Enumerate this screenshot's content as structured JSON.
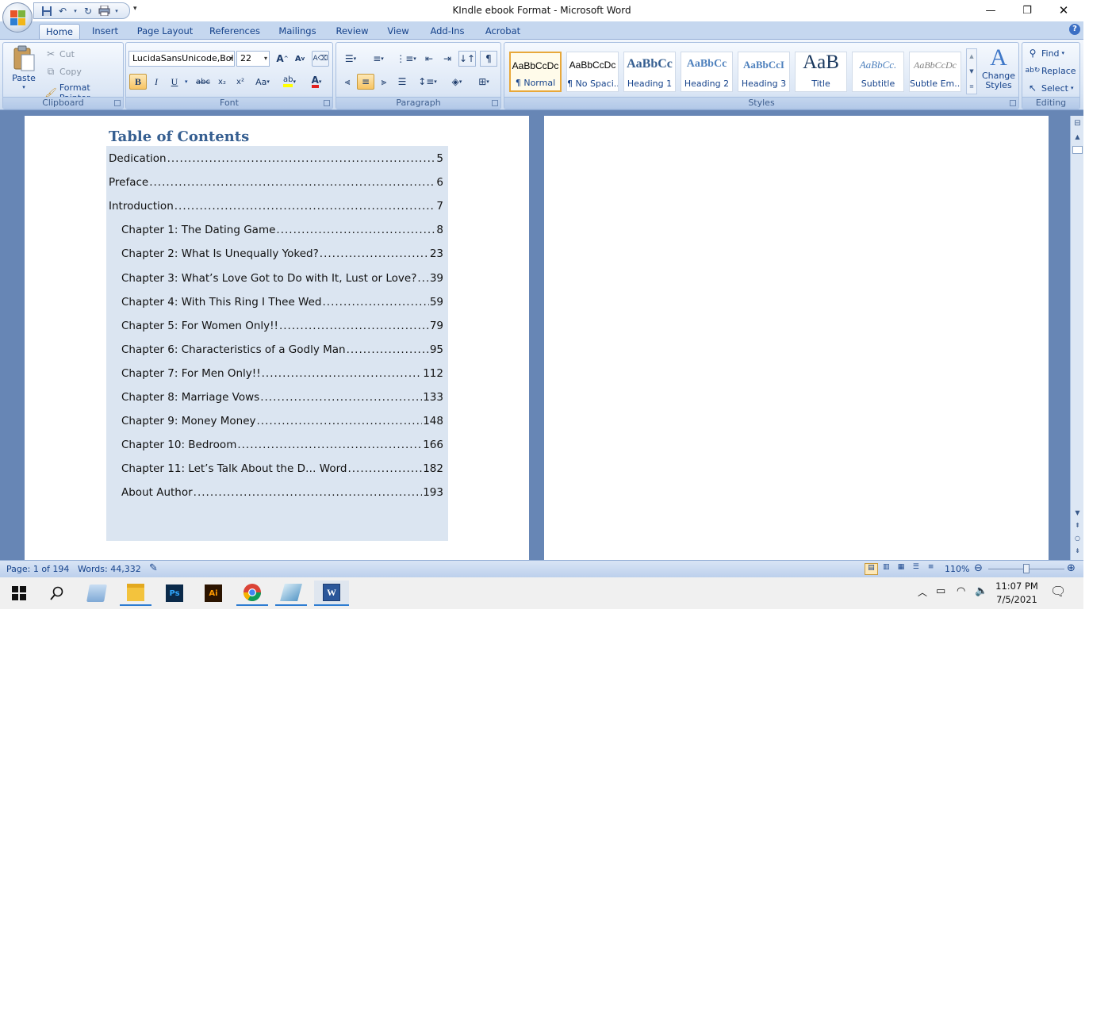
{
  "title": "KIndle ebook Format - Microsoft Word",
  "window_controls": {
    "minimize": "—",
    "restore": "❐",
    "close": "✕"
  },
  "qat": {
    "more": "▾"
  },
  "tabs": [
    "Home",
    "Insert",
    "Page Layout",
    "References",
    "Mailings",
    "Review",
    "View",
    "Add-Ins",
    "Acrobat"
  ],
  "active_tab": "Home",
  "help": "?",
  "clipboard": {
    "label": "Clipboard",
    "paste": "Paste",
    "cut": "Cut",
    "copy": "Copy",
    "format_painter": "Format Painter"
  },
  "font": {
    "label": "Font",
    "family": "LucidaSansUnicode,Bol",
    "size": "22",
    "grow": "A",
    "shrink": "A",
    "bold": "B",
    "italic": "I",
    "underline": "U",
    "strike": "abc",
    "subscript": "x₂",
    "superscript": "x²",
    "change_case": "Aa",
    "highlight": "ab",
    "font_color": "A"
  },
  "paragraph": {
    "label": "Paragraph",
    "show_marks": "¶"
  },
  "styles": {
    "label": "Styles",
    "items": [
      {
        "preview": "AaBbCcDc",
        "name": "¶ Normal"
      },
      {
        "preview": "AaBbCcDc",
        "name": "¶ No Spaci..."
      },
      {
        "preview": "AaBbCc",
        "name": "Heading 1"
      },
      {
        "preview": "AaBbCc",
        "name": "Heading 2"
      },
      {
        "preview": "AaBbCcI",
        "name": "Heading 3"
      },
      {
        "preview": "AaB",
        "name": "Title"
      },
      {
        "preview": "AaBbCc.",
        "name": "Subtitle"
      },
      {
        "preview": "AaBbCcDc",
        "name": "Subtle Em..."
      }
    ],
    "change_styles": "Change Styles",
    "change_styles_icon": "A"
  },
  "editing": {
    "label": "Editing",
    "find": "Find",
    "replace": "Replace",
    "select": "Select"
  },
  "document": {
    "heading": "Table of Contents",
    "toc": [
      {
        "title": "Dedication",
        "page": "5",
        "level": 1
      },
      {
        "title": "Preface",
        "page": "6",
        "level": 1
      },
      {
        "title": "Introduction",
        "page": "7",
        "level": 1
      },
      {
        "title": "Chapter 1: The Dating Game",
        "page": "8",
        "level": 2
      },
      {
        "title": "Chapter 2: What Is Unequally Yoked?",
        "page": "23",
        "level": 2
      },
      {
        "title": "Chapter 3: What’s Love Got to Do with It, Lust or Love?",
        "page": "39",
        "level": 2
      },
      {
        "title": "Chapter 4: With This Ring I Thee Wed",
        "page": "59",
        "level": 2
      },
      {
        "title": "Chapter 5: For Women Only!!",
        "page": "79",
        "level": 2
      },
      {
        "title": "Chapter 6: Characteristics of a Godly Man",
        "page": "95",
        "level": 2
      },
      {
        "title": "Chapter 7: For Men Only!!",
        "page": "112",
        "level": 2
      },
      {
        "title": "Chapter 8: Marriage Vows",
        "page": "133",
        "level": 2
      },
      {
        "title": "Chapter 9: Money Money",
        "page": "148",
        "level": 2
      },
      {
        "title": "Chapter 10: Bedroom",
        "page": "166",
        "level": 2
      },
      {
        "title": "Chapter 11: Let’s Talk About the D… Word",
        "page": "182",
        "level": 2
      },
      {
        "title": "About Author",
        "page": "193",
        "level": 2
      }
    ]
  },
  "status": {
    "page": "Page: 1 of 194",
    "words": "Words: 44,332",
    "zoom": "110%"
  },
  "taskbar": {
    "time": "11:07 PM",
    "date": "7/5/2021",
    "photoshop": "Ps",
    "illustrator": "Ai",
    "word": "W"
  }
}
